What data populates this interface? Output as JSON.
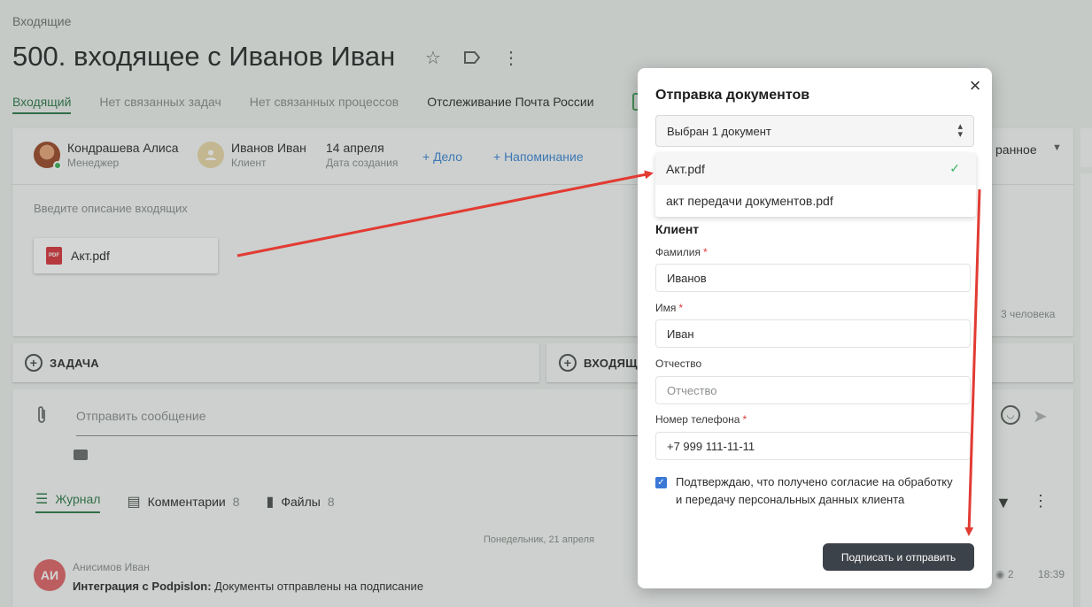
{
  "page": {
    "breadcrumb": "Входящие",
    "title": "500. входящее с Иванов Иван",
    "tabs": [
      "Входящий",
      "Нет связанных задач",
      "Нет связанных процессов",
      "Отслеживание Почта России"
    ],
    "icons": [
      "star-icon",
      "tag-icon",
      "kebab-icon"
    ]
  },
  "card": {
    "manager_name": "Кондрашева Алиса",
    "manager_role": "Менеджер",
    "client_name": "Иванов Иван",
    "client_role": "Клиент",
    "created_date": "14 апреля",
    "created_label": "Дата создания",
    "add_case": "+ Дело",
    "add_reminder": "+ Напоминание",
    "right_selector": "ранное",
    "description_placeholder": "Введите описание входящих",
    "attachment_name": "Акт.pdf",
    "attachment_type": "PDF",
    "people_count": "3 человека"
  },
  "actions": {
    "task_label": "ЗАДАЧА",
    "incoming_label": "ВХОДЯЩ"
  },
  "feed": {
    "message_placeholder": "Отправить сообщение",
    "tab_journal": "Журнал",
    "tab_comments": "Комментарии",
    "comments_count": "8",
    "tab_files": "Файлы",
    "files_count": "8",
    "date_separator": "Понедельник, 21 апреля",
    "author_initials": "АИ",
    "author_name": "Анисимов Иван",
    "event_source": "Интеграция с Podpislon:",
    "event_text": " Документы отправлены на подписание",
    "views": "2",
    "time": "18:39"
  },
  "modal": {
    "title": "Отправка документов",
    "selected_summary": "Выбран 1 документ",
    "documents": [
      "Акт.pdf",
      "акт передачи документов.pdf"
    ],
    "section_client": "Клиент",
    "surname_label": "Фамилия",
    "surname_value": "Иванов",
    "name_label": "Имя",
    "name_value": "Иван",
    "patronymic_label": "Отчество",
    "patronymic_placeholder": "Отчество",
    "phone_label": "Номер телефона",
    "phone_value": "+7 999 111-11-11",
    "required_mark": "*",
    "consent_text": "Подтверждаю, что получено согласие на обработку и передачу персональных данных клиента",
    "submit_label": "Подписать и отправить"
  },
  "colors": {
    "accent_green": "#2f7a4a",
    "link_blue": "#3e86d6",
    "annotation_red": "#e23b33",
    "submit_bg": "#3c4249"
  }
}
